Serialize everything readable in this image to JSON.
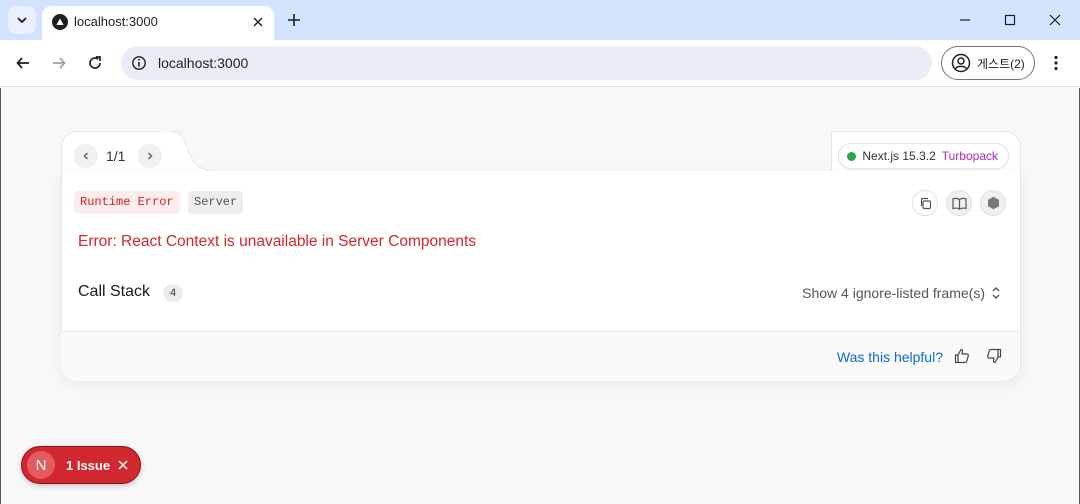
{
  "browser": {
    "tab_title": "localhost:3000",
    "url": "localhost:3000",
    "profile_label": "게스트(2)"
  },
  "overlay": {
    "pager": "1/1",
    "version": "Next.js 15.3.2",
    "bundler": "Turbopack",
    "labels": {
      "runtime": "Runtime Error",
      "server": "Server"
    },
    "error_message": "Error: React Context is unavailable in Server Components",
    "call_stack": {
      "title": "Call Stack",
      "count": "4",
      "toggle_label": "Show 4 ignore-listed frame(s)"
    },
    "feedback": {
      "question": "Was this helpful?"
    },
    "colors": {
      "error_red": "#d0262e",
      "status_green": "#28a745",
      "link_blue": "#0b69d6"
    }
  },
  "issue_badge": {
    "avatar_letter": "N",
    "label": "1 Issue"
  }
}
